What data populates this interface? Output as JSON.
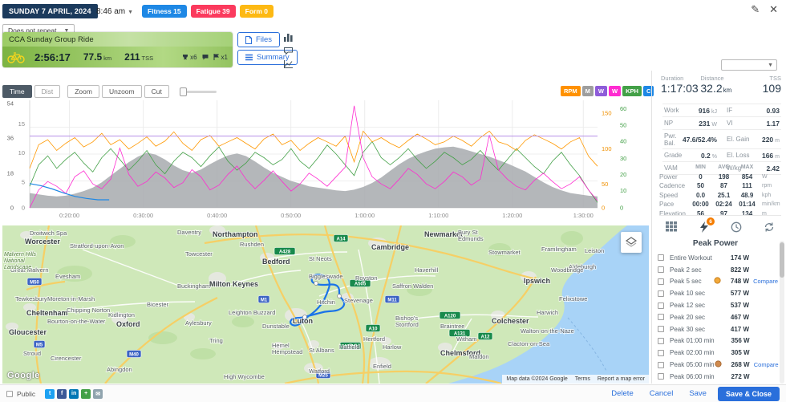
{
  "header": {
    "date": "SUNDAY 7 APRIL, 2024",
    "time": "8:46 am",
    "repeat": "Does not repeat",
    "badges": [
      {
        "label": "Fitness 15",
        "color": "#1e88e5"
      },
      {
        "label": "Fatigue 39",
        "color": "#fb3a5d"
      },
      {
        "label": "Form 0",
        "color": "#fdb913"
      }
    ]
  },
  "workout": {
    "title": "CCA Sunday Group Ride",
    "duration": "2:56:17",
    "distance": "77.5",
    "distance_unit": "km",
    "tss": "211",
    "tss_unit": "TSS",
    "peaks_count": "x6",
    "records_count": "x1",
    "files_label": "Files",
    "summary_label": "Summary"
  },
  "chart": {
    "toolbar": {
      "time": "Time",
      "dist": "Dist",
      "zoom": "Zoom",
      "unzoom": "Unzoom",
      "cut": "Cut"
    },
    "channels": [
      {
        "label": "RPM",
        "color": "#ff9100"
      },
      {
        "label": "M",
        "color": "#9e9e9e"
      },
      {
        "label": "W",
        "color": "#8e5cd9"
      },
      {
        "label": "W",
        "color": "#ff2bd1"
      },
      {
        "label": "KPH",
        "color": "#43a047"
      },
      {
        "label": "C",
        "color": "#1e88e5"
      }
    ]
  },
  "chart_data": {
    "type": "line",
    "x_ticks": [
      "0:20:00",
      "0:30:00",
      "0:40:00",
      "0:50:00",
      "1:00:00",
      "1:10:00",
      "1:20:00",
      "1:30:00"
    ],
    "x_tick_fractions": [
      0.07,
      0.2,
      0.33,
      0.46,
      0.59,
      0.72,
      0.85,
      0.975
    ],
    "left_axis_primary": {
      "ticks": [
        54,
        36,
        18,
        0
      ],
      "fractions": [
        0.03,
        0.35,
        0.68,
        1
      ]
    },
    "left_axis_secondary": {
      "ticks": [
        15,
        10,
        5,
        0
      ],
      "fractions": [
        0.22,
        0.49,
        0.76,
        1
      ]
    },
    "right_axis_cadence": {
      "color": "#f09000",
      "ticks": [
        150,
        100,
        50,
        0
      ],
      "fractions": [
        0.12,
        0.45,
        0.78,
        1
      ]
    },
    "right_axis_speed": {
      "color": "#43a047",
      "ticks": [
        60,
        50,
        40,
        30,
        20,
        10,
        0
      ],
      "fractions": [
        0.08,
        0.23,
        0.38,
        0.54,
        0.69,
        0.84,
        1
      ]
    },
    "reference_line": {
      "color": "#b78fe8",
      "value": 100,
      "range": [
        0,
        150
      ]
    },
    "series": [
      {
        "name": "elevation",
        "type": "area",
        "color": "#a7aaae",
        "range": [
          40,
          200
        ],
        "values": [
          62,
          60,
          58,
          57,
          58,
          61,
          65,
          70,
          78,
          88,
          98,
          108,
          116,
          122,
          119,
          112,
          103,
          96,
          92,
          97,
          105,
          112,
          118,
          121,
          117,
          109,
          100,
          92,
          86,
          80,
          76,
          72,
          70,
          68,
          66,
          65,
          67,
          71,
          77,
          85,
          95,
          105,
          113,
          119,
          124,
          128,
          130,
          131,
          128,
          124,
          120,
          116,
          111,
          106,
          100,
          94,
          86,
          78,
          71,
          66,
          62,
          60,
          58,
          57
        ]
      },
      {
        "name": "speed",
        "type": "line",
        "color": "#43a047",
        "range": [
          0,
          60
        ],
        "values": [
          12,
          24,
          29,
          22,
          27,
          31,
          25,
          20,
          28,
          33,
          27,
          21,
          26,
          32,
          24,
          19,
          26,
          31,
          28,
          23,
          29,
          34,
          26,
          21,
          25,
          31,
          28,
          24,
          27,
          33,
          26,
          22,
          28,
          35,
          30,
          24,
          18,
          31,
          37,
          28,
          24,
          28,
          33,
          27,
          22,
          26,
          31,
          28,
          24,
          27,
          32,
          26,
          21,
          27,
          33,
          28,
          23,
          19,
          26,
          31,
          24,
          18,
          10,
          3
        ]
      },
      {
        "name": "cadence",
        "type": "line",
        "color": "#ff9800",
        "range": [
          0,
          150
        ],
        "values": [
          55,
          88,
          95,
          80,
          90,
          98,
          85,
          92,
          104,
          88,
          95,
          82,
          90,
          99,
          86,
          93,
          106,
          90,
          80,
          95,
          101,
          86,
          92,
          98,
          90,
          82,
          96,
          103,
          88,
          94,
          80,
          90,
          98,
          92,
          86,
          100,
          64,
          107,
          92,
          98,
          90,
          84,
          94,
          103,
          96,
          88,
          92,
          100,
          94,
          86,
          98,
          107,
          92,
          88,
          80,
          94,
          102,
          96,
          90,
          82,
          92,
          98,
          72,
          58
        ]
      },
      {
        "name": "power",
        "type": "line",
        "color": "#ff2bd1",
        "range": [
          0,
          900
        ],
        "values": [
          0,
          150,
          220,
          180,
          120,
          260,
          310,
          200,
          160,
          240,
          500,
          280,
          180,
          220,
          300,
          250,
          170,
          210,
          320,
          260,
          150,
          190,
          280,
          350,
          240,
          160,
          230,
          310,
          220,
          140,
          200,
          290,
          240,
          180,
          260,
          340,
          854,
          420,
          260,
          200,
          160,
          240,
          330,
          280,
          200,
          160,
          220,
          300,
          260,
          190,
          240,
          610,
          320,
          240,
          180,
          150,
          230,
          290,
          220,
          160,
          200,
          260,
          150,
          60
        ]
      },
      {
        "name": "temperature",
        "type": "line",
        "color": "#1e88e5",
        "range": [
          0,
          160
        ],
        "span": [
          0,
          0.14
        ],
        "values": [
          36,
          33,
          28,
          22,
          17,
          14,
          12,
          12
        ]
      }
    ]
  },
  "map": {
    "google": "Google",
    "attribution": "Map data ©2024 Google",
    "terms": "Terms",
    "report": "Report a map error",
    "labels": [
      [
        "Droitwich Spa",
        34,
        6,
        "town"
      ],
      [
        "Worcester",
        28,
        17,
        "city"
      ],
      [
        "Great Malvern",
        10,
        52,
        "town"
      ],
      [
        "Malvern Hills",
        2,
        32,
        "park"
      ],
      [
        "National",
        2,
        40,
        "park"
      ],
      [
        "Landscape",
        2,
        48,
        "park"
      ],
      [
        "Tewkesbury",
        16,
        88,
        "town"
      ],
      [
        "Cheltenham",
        30,
        106,
        "city"
      ],
      [
        "Gloucester",
        8,
        130,
        "city"
      ],
      [
        "Stroud",
        26,
        156,
        "town"
      ],
      [
        "Cirencester",
        60,
        162,
        "town"
      ],
      [
        "Stratford-upon-Avon",
        84,
        22,
        "town"
      ],
      [
        "Evesham",
        66,
        60,
        "town"
      ],
      [
        "Moreton-in-Marsh",
        56,
        88,
        "town"
      ],
      [
        "Chipping Norton",
        80,
        102,
        "town"
      ],
      [
        "Bourton-on-the-Water",
        56,
        116,
        "town"
      ],
      [
        "Kidlington",
        132,
        108,
        "town"
      ],
      [
        "Oxford",
        142,
        120,
        "city"
      ],
      [
        "Abingdon",
        130,
        176,
        "town"
      ],
      [
        "Daventry",
        218,
        5,
        "town"
      ],
      [
        "Northampton",
        262,
        8,
        "city"
      ],
      [
        "Towcester",
        228,
        32,
        "town"
      ],
      [
        "Buckingham",
        218,
        72,
        "town"
      ],
      [
        "Bicester",
        180,
        95,
        "town"
      ],
      [
        "Aylesbury",
        228,
        118,
        "town"
      ],
      [
        "Tring",
        258,
        140,
        "town"
      ],
      [
        "Leighton Buzzard",
        282,
        105,
        "town"
      ],
      [
        "Milton Keynes",
        258,
        70,
        "city"
      ],
      [
        "Bedford",
        324,
        42,
        "city"
      ],
      [
        "Rushden",
        296,
        20,
        "town"
      ],
      [
        "St Neots",
        382,
        38,
        "town"
      ],
      [
        "Cambridge",
        460,
        24,
        "city"
      ],
      [
        "Newmarket",
        526,
        8,
        "city"
      ],
      [
        "Bury St",
        568,
        5,
        "town"
      ],
      [
        "Edmunds",
        568,
        13,
        "town"
      ],
      [
        "Stowmarket",
        606,
        30,
        "town"
      ],
      [
        "Framlingham",
        672,
        26,
        "town"
      ],
      [
        "Leiston",
        726,
        28,
        "town"
      ],
      [
        "Aldeburgh",
        706,
        48,
        "town"
      ],
      [
        "Woodbridge",
        684,
        52,
        "town"
      ],
      [
        "Ipswich",
        650,
        66,
        "city"
      ],
      [
        "Felixstowe",
        694,
        88,
        "town"
      ],
      [
        "Harwich",
        666,
        105,
        "town"
      ],
      [
        "Haverhill",
        514,
        52,
        "town"
      ],
      [
        "Saffron Walden",
        486,
        72,
        "town"
      ],
      [
        "Royston",
        440,
        62,
        "town"
      ],
      [
        "Biggleswade",
        382,
        60,
        "town"
      ],
      [
        "Hitchin",
        392,
        92,
        "town"
      ],
      [
        "Stevenage",
        426,
        90,
        "town"
      ],
      [
        "Luton",
        362,
        116,
        "city"
      ],
      [
        "Dunstable",
        324,
        122,
        "town"
      ],
      [
        "Hemel",
        336,
        146,
        "town"
      ],
      [
        "Hempstead",
        336,
        154,
        "town"
      ],
      [
        "St Albans",
        382,
        152,
        "town"
      ],
      [
        "Hatfield",
        420,
        148,
        "town"
      ],
      [
        "Hertford",
        450,
        138,
        "town"
      ],
      [
        "Harlow",
        474,
        148,
        "town"
      ],
      [
        "Watford",
        382,
        178,
        "town"
      ],
      [
        "Enfield",
        462,
        172,
        "town"
      ],
      [
        "High Wycombe",
        276,
        185,
        "town"
      ],
      [
        "Chelmsford",
        546,
        156,
        "city"
      ],
      [
        "Braintree",
        546,
        122,
        "town"
      ],
      [
        "Witham",
        566,
        138,
        "town"
      ],
      [
        "Colchester",
        610,
        116,
        "city"
      ],
      [
        "Maldon",
        582,
        160,
        "town"
      ],
      [
        "Clacton-on-Sea",
        630,
        144,
        "town"
      ],
      [
        "Walton-on-the-Naze",
        646,
        128,
        "town"
      ],
      [
        "Bishop's",
        490,
        112,
        "town"
      ],
      [
        "Stortford",
        490,
        120,
        "town"
      ]
    ],
    "shields": [
      [
        "M50",
        40,
        70,
        "m"
      ],
      [
        "M5",
        46,
        148,
        "m"
      ],
      [
        "M40",
        164,
        160,
        "m"
      ],
      [
        "M1",
        326,
        92,
        "m"
      ],
      [
        "M11",
        486,
        92,
        "m"
      ],
      [
        "M25",
        400,
        186,
        "m"
      ],
      [
        "A14",
        422,
        16,
        "a"
      ],
      [
        "A1(M)",
        434,
        150,
        "a"
      ],
      [
        "A10",
        462,
        128,
        "a"
      ],
      [
        "A505",
        446,
        72,
        "a"
      ],
      [
        "A120",
        558,
        112,
        "a"
      ],
      [
        "A131",
        570,
        134,
        "a"
      ],
      [
        "A12",
        602,
        138,
        "a"
      ],
      [
        "A428",
        352,
        32,
        "a"
      ]
    ]
  },
  "panel": {
    "summary": {
      "duration_label": "Duration",
      "duration": "1:17:03",
      "distance_label": "Distance",
      "distance": "32.2",
      "distance_unit": "km",
      "tss_label": "TSS",
      "tss": "109"
    },
    "metrics": [
      {
        "label": "Work",
        "value": "916",
        "unit": "kJ"
      },
      {
        "label": "IF",
        "value": "0.93",
        "unit": ""
      },
      {
        "label": "NP",
        "value": "231",
        "unit": "W"
      },
      {
        "label": "VI",
        "value": "1.17",
        "unit": ""
      },
      {
        "label": "Pwr. Bal.",
        "value": "47.6/52.4%",
        "unit": ""
      },
      {
        "label": "El. Gain",
        "value": "220",
        "unit": "m"
      },
      {
        "label": "Grade",
        "value": "0.2",
        "unit": "%"
      },
      {
        "label": "El. Loss",
        "value": "166",
        "unit": "m"
      },
      {
        "label": "VAM",
        "value": "",
        "unit": ""
      },
      {
        "label": "W/kg",
        "value": "2.42",
        "unit": ""
      }
    ],
    "stats_table": {
      "headers": [
        "MIN",
        "AVG",
        "MAX"
      ],
      "rows": [
        {
          "name": "Power",
          "min": "0",
          "avg": "198",
          "max": "854",
          "unit": "W"
        },
        {
          "name": "Cadence",
          "min": "50",
          "avg": "87",
          "max": "111",
          "unit": "rpm"
        },
        {
          "name": "Speed",
          "min": "0.0",
          "avg": "25.1",
          "max": "48.9",
          "unit": "kph"
        },
        {
          "name": "Pace",
          "min": "00:00",
          "avg": "02:24",
          "max": "01:14",
          "unit": "min/km"
        },
        {
          "name": "Elevation",
          "min": "56",
          "avg": "97",
          "max": "134",
          "unit": "m"
        }
      ]
    },
    "peaks": {
      "title": "Peak Power",
      "badge": "6",
      "compare_label": "Compare",
      "rows": [
        {
          "label": "Entire Workout",
          "value": "174 W"
        },
        {
          "label": "Peak 2 sec",
          "value": "822 W"
        },
        {
          "label": "Peak 5 sec",
          "value": "748 W",
          "trophy": "gold",
          "compare": true
        },
        {
          "label": "Peak 10 sec",
          "value": "577 W"
        },
        {
          "label": "Peak 12 sec",
          "value": "537 W"
        },
        {
          "label": "Peak 20 sec",
          "value": "467 W"
        },
        {
          "label": "Peak 30 sec",
          "value": "417 W"
        },
        {
          "label": "Peak 01:00 min",
          "value": "356 W"
        },
        {
          "label": "Peak 02:00 min",
          "value": "305 W"
        },
        {
          "label": "Peak 05:00 min",
          "value": "268 W",
          "trophy": "bronze",
          "compare": true
        },
        {
          "label": "Peak 06:00 min",
          "value": "272 W"
        }
      ]
    }
  },
  "footer": {
    "public": "Public",
    "delete": "Delete",
    "cancel": "Cancel",
    "save": "Save",
    "save_close": "Save & Close",
    "social": [
      {
        "name": "twitter",
        "bg": "#1da1f2",
        "glyph": "t"
      },
      {
        "name": "facebook",
        "bg": "#3b5998",
        "glyph": "f"
      },
      {
        "name": "linkedin",
        "bg": "#0077b5",
        "glyph": "in"
      },
      {
        "name": "share",
        "bg": "#43a047",
        "glyph": "+"
      },
      {
        "name": "email",
        "bg": "#90a4ae",
        "glyph": "✉"
      }
    ]
  }
}
